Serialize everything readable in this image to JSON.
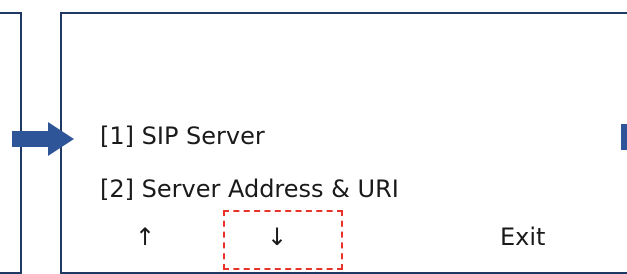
{
  "menu": {
    "items": [
      {
        "label": "[1] SIP Server"
      },
      {
        "label": "[2] Server Address & URI"
      }
    ]
  },
  "softkeys": {
    "up_label": "↑",
    "down_label": "↓",
    "exit_label": "Exit"
  },
  "highlight": {
    "target": "down",
    "color": "#e8332a"
  },
  "colors": {
    "border": "#1f3864",
    "arrow": "#2e5597",
    "text": "#1a1a1a"
  }
}
